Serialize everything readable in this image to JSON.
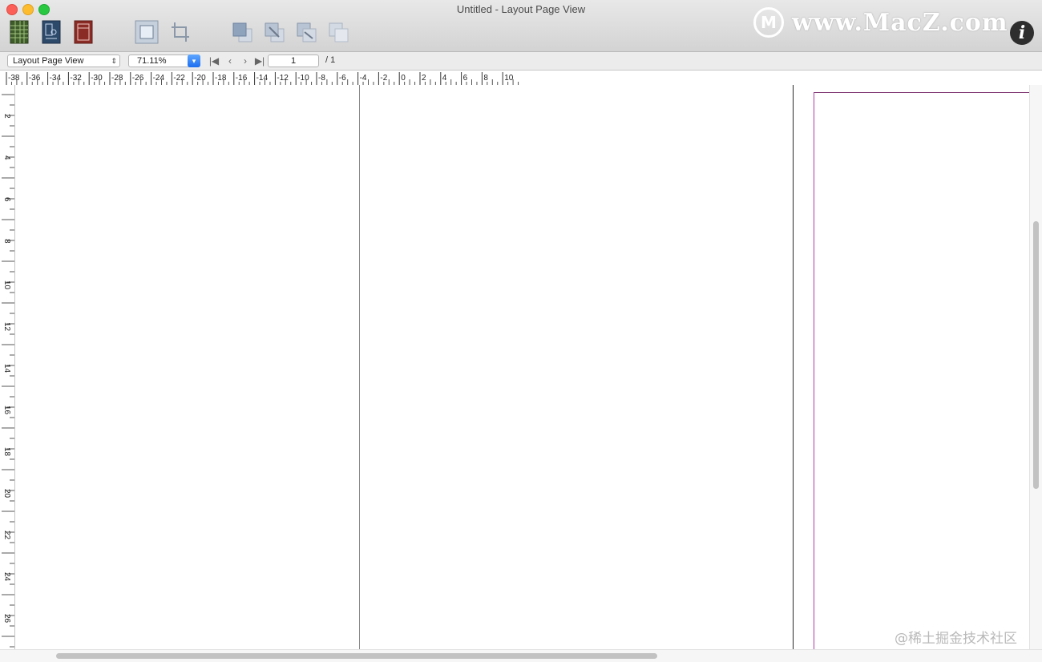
{
  "window": {
    "title": "Untitled - Layout Page View"
  },
  "toolbar": {
    "buttons": [
      {
        "name": "spreadsheet-view",
        "icon": "spreadsheet-icon",
        "color": "#3e5b2a"
      },
      {
        "name": "card-view",
        "icon": "card-view-icon",
        "color": "#2e4a6b"
      },
      {
        "name": "layout-view",
        "icon": "layout-view-icon",
        "color": "#8a2c25"
      },
      {
        "name": "object-frame",
        "icon": "frame-icon"
      },
      {
        "name": "crop",
        "icon": "crop-icon"
      },
      {
        "name": "bring-to-front",
        "icon": "bring-front-icon"
      },
      {
        "name": "bring-forward",
        "icon": "bring-forward-icon"
      },
      {
        "name": "send-backward",
        "icon": "send-backward-icon"
      },
      {
        "name": "send-to-back",
        "icon": "send-back-icon"
      }
    ],
    "info_label": "i"
  },
  "watermark": {
    "logo": "M",
    "text": "www.MacZ.com"
  },
  "navbar": {
    "view_select": "Layout Page View",
    "zoom": "71.11%",
    "page_current": "1",
    "page_total": "/ 1"
  },
  "ruler": {
    "horizontal": [
      "-38",
      "-36",
      "-34",
      "-32",
      "-30",
      "-28",
      "-26",
      "-24",
      "-22",
      "-20",
      "-18",
      "-16",
      "-14",
      "-12",
      "-10",
      "-8",
      "-6",
      "-4",
      "-2",
      "0",
      "2",
      "4",
      "6",
      "8",
      "10"
    ],
    "vertical": [
      "2",
      "4",
      "6",
      "8",
      "10",
      "12",
      "14",
      "16",
      "18",
      "20",
      "22",
      "24",
      "26"
    ]
  },
  "attribution": "@稀土掘金技术社区"
}
